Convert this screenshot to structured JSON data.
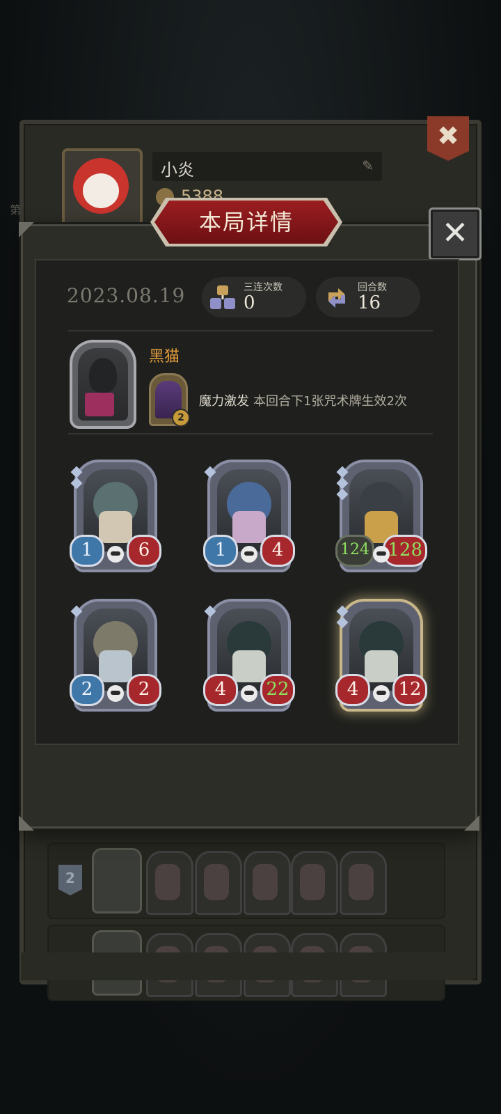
{
  "profile": {
    "name": "小炎",
    "coins": "5388",
    "side_label": "第"
  },
  "history": {
    "row1_rank": "2"
  },
  "modal": {
    "title": "本局详情",
    "date": "2023.08.19",
    "triples_label": "三连次数",
    "triples_value": "0",
    "rounds_label": "回合数",
    "rounds_value": "16"
  },
  "boss": {
    "name": "黑猫",
    "spell_level": "2",
    "ability_name": "魔力激发",
    "ability_desc": "本回合下1张咒术牌生效2次"
  },
  "units": [
    {
      "attack": "1",
      "health": "6",
      "attack_color": "blue",
      "health_color": "red",
      "gold": false
    },
    {
      "attack": "1",
      "health": "4",
      "attack_color": "blue",
      "health_color": "red",
      "gold": false
    },
    {
      "attack": "124",
      "health": "128",
      "attack_color": "green",
      "health_color": "green",
      "gold": false
    },
    {
      "attack": "2",
      "health": "2",
      "attack_color": "blue",
      "health_color": "red",
      "gold": false
    },
    {
      "attack": "4",
      "health": "22",
      "attack_color": "red",
      "health_color": "green",
      "gold": false
    },
    {
      "attack": "4",
      "health": "12",
      "attack_color": "red",
      "health_color": "red",
      "gold": true
    }
  ],
  "icons": {
    "close": "close-icon",
    "edit": "pencil-icon",
    "coin": "coin-icon",
    "triples": "cubes-icon",
    "rounds": "cycle-arrows-icon",
    "skull": "skull-icon"
  },
  "colors": {
    "title_banner": "#8b1a1c",
    "boss_name": "#e09a3a",
    "attack_blue": "#3f78a8",
    "health_red": "#a6282c",
    "buffed_green": "#8ee060"
  }
}
